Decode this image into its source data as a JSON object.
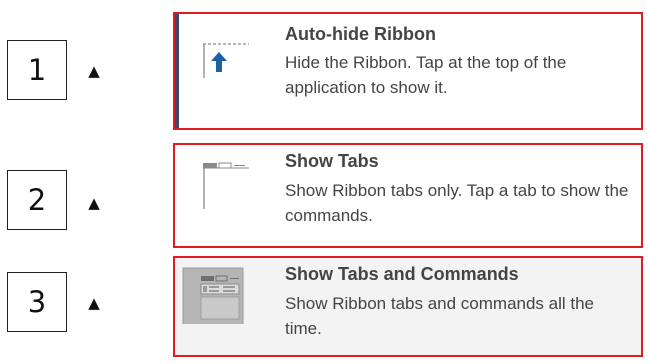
{
  "markers": [
    {
      "number": "1",
      "arrow": "▲"
    },
    {
      "number": "2",
      "arrow": "▲"
    },
    {
      "number": "3",
      "arrow": "▲"
    }
  ],
  "options": [
    {
      "title": "Auto-hide Ribbon",
      "description": "Hide the Ribbon. Tap at the top of the application to show it.",
      "icon": "auto-hide-ribbon-icon"
    },
    {
      "title": "Show Tabs",
      "description": "Show Ribbon tabs only. Tap a tab to show the commands.",
      "icon": "show-tabs-icon"
    },
    {
      "title": "Show Tabs and Commands",
      "description": "Show Ribbon tabs and commands all the time.",
      "icon": "show-tabs-and-commands-icon"
    }
  ],
  "colors": {
    "highlight_border": "#e01b24",
    "accent_arrow": "#1f5fa8",
    "text": "#444444",
    "selected_background": "#f3f3f3"
  }
}
